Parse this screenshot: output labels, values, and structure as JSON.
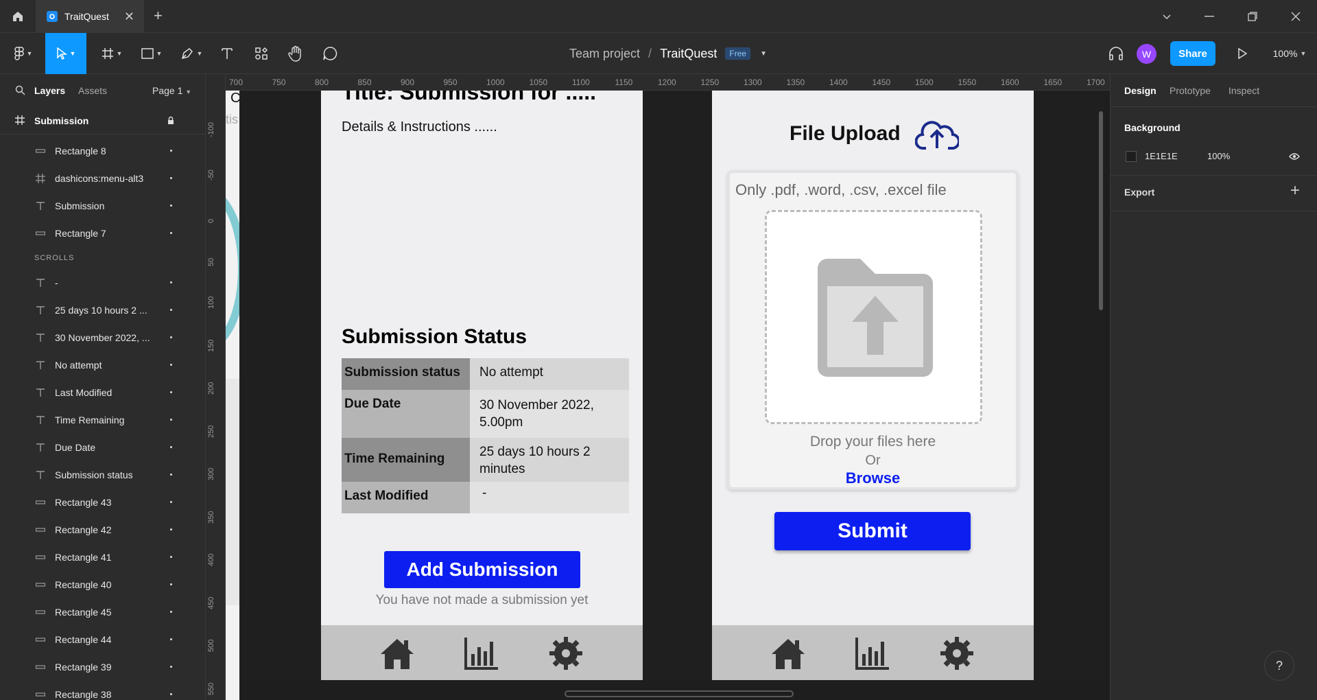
{
  "window": {
    "tab_title": "TraitQuest",
    "close_symbol": "✕",
    "new_tab_symbol": "+"
  },
  "toolbar": {
    "breadcrumb_team": "Team project",
    "breadcrumb_sep": "/",
    "breadcrumb_file": "TraitQuest",
    "plan_badge": "Free",
    "avatar_initial": "W",
    "share_label": "Share",
    "zoom": "100%"
  },
  "layers_panel": {
    "tab_layers": "Layers",
    "tab_assets": "Assets",
    "page_label": "Page 1",
    "frame_name": "Submission",
    "items_top": [
      {
        "icon": "rect",
        "label": "Rectangle 8"
      },
      {
        "icon": "frame",
        "label": "dashicons:menu-alt3"
      },
      {
        "icon": "text",
        "label": "Submission"
      },
      {
        "icon": "rect",
        "label": "Rectangle 7"
      }
    ],
    "section_label": "SCROLLS",
    "items_scroll": [
      {
        "icon": "text",
        "label": "-"
      },
      {
        "icon": "text",
        "label": "25 days 10 hours 2 ..."
      },
      {
        "icon": "text",
        "label": "30 November 2022, ..."
      },
      {
        "icon": "text",
        "label": "No attempt"
      },
      {
        "icon": "text",
        "label": "Last Modified"
      },
      {
        "icon": "text",
        "label": "Time Remaining"
      },
      {
        "icon": "text",
        "label": "Due Date"
      },
      {
        "icon": "text",
        "label": "Submission status"
      },
      {
        "icon": "rect",
        "label": "Rectangle 43"
      },
      {
        "icon": "rect",
        "label": "Rectangle 42"
      },
      {
        "icon": "rect",
        "label": "Rectangle 41"
      },
      {
        "icon": "rect",
        "label": "Rectangle 40"
      },
      {
        "icon": "rect",
        "label": "Rectangle 45"
      },
      {
        "icon": "rect",
        "label": "Rectangle 44"
      },
      {
        "icon": "rect",
        "label": "Rectangle 39"
      },
      {
        "icon": "rect",
        "label": "Rectangle 38"
      }
    ]
  },
  "rulers": {
    "top": [
      "700",
      "750",
      "800",
      "850",
      "900",
      "950",
      "1000",
      "1050",
      "1100",
      "1150",
      "1200",
      "1250",
      "1300",
      "1350",
      "1400",
      "1450",
      "1500",
      "1550",
      "1600",
      "1650",
      "1700"
    ],
    "left": [
      "-100",
      "-50",
      "0",
      "50",
      "100",
      "150",
      "200",
      "250",
      "300",
      "350",
      "400",
      "450",
      "500",
      "550"
    ]
  },
  "canvas": {
    "edge_letter": "C",
    "edge_text": "tis",
    "submission_screen": {
      "title": "Title: Submission for .....",
      "details": "Details & Instructions ......",
      "status_heading": "Submission Status",
      "rows": [
        {
          "key": "Submission status",
          "value": "No attempt"
        },
        {
          "key": "Due Date",
          "value": "30 November 2022, 5.00pm"
        },
        {
          "key": "Time Remaining",
          "value": "25 days 10 hours 2 minutes"
        },
        {
          "key": "Last Modified",
          "value": "-"
        }
      ],
      "add_button": "Add Submission",
      "no_submission_text": "You have not made a submission yet"
    },
    "upload_screen": {
      "title": "File Upload",
      "accepted_types": "Only .pdf, .word, .csv, .excel file",
      "drop_text": "Drop your files here",
      "or_text": "Or",
      "browse_link": "Browse",
      "submit_button": "Submit"
    },
    "colors": {
      "primary_button": "#0c1ff0",
      "screen_background": "#efeff1",
      "nav_bar": "#c3c3c3"
    }
  },
  "design_panel": {
    "tab_design": "Design",
    "tab_prototype": "Prototype",
    "tab_inspect": "Inspect",
    "background_label": "Background",
    "background_hex": "1E1E1E",
    "background_opacity": "100%",
    "export_label": "Export",
    "export_add": "+"
  },
  "help": "?"
}
